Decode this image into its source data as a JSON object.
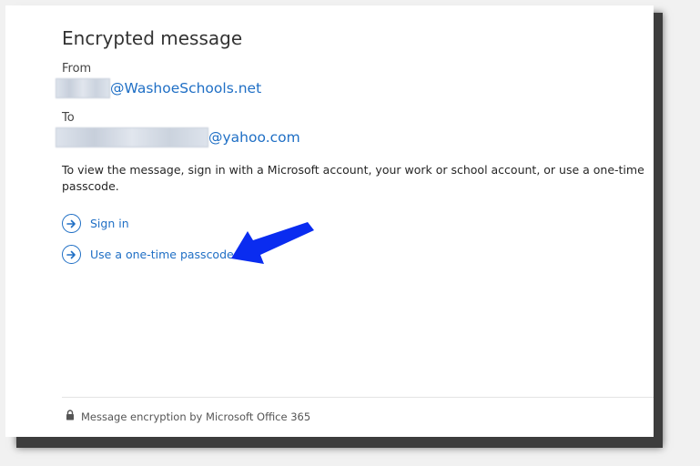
{
  "page": {
    "title": "Encrypted message"
  },
  "from": {
    "label": "From",
    "redacted_name": "DRyfold",
    "domain": "@WashoeSchools.net"
  },
  "to": {
    "label": "To",
    "redacted_name": "morrisdesigncompany",
    "domain": "@yahoo.com"
  },
  "instructions": "To view the message, sign in with a Microsoft account, your work or school account, or use a one-time passcode.",
  "actions": {
    "sign_in": "Sign in",
    "one_time_passcode": "Use a one-time passcode"
  },
  "footer": {
    "text": "Message encryption by Microsoft Office 365",
    "icon": "lock-icon"
  },
  "colors": {
    "link": "#1f6fc5",
    "annotation_arrow": "#0a2cf0"
  }
}
